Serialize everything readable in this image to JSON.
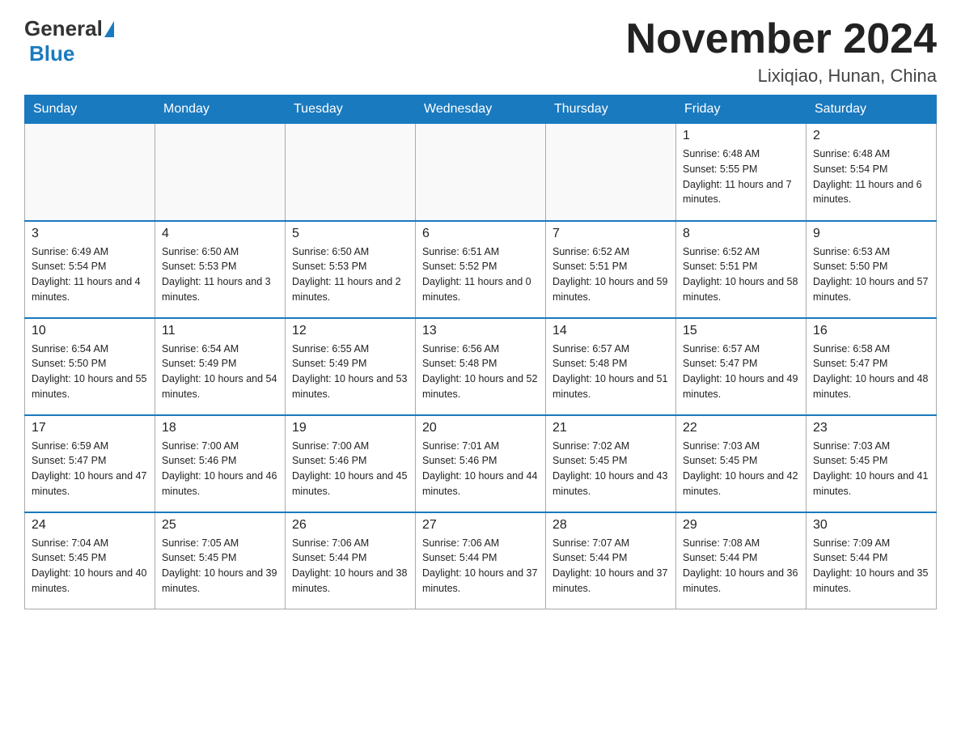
{
  "logo": {
    "general": "General",
    "blue": "Blue"
  },
  "title": "November 2024",
  "location": "Lixiqiao, Hunan, China",
  "days_of_week": [
    "Sunday",
    "Monday",
    "Tuesday",
    "Wednesday",
    "Thursday",
    "Friday",
    "Saturday"
  ],
  "weeks": [
    [
      {
        "day": "",
        "info": ""
      },
      {
        "day": "",
        "info": ""
      },
      {
        "day": "",
        "info": ""
      },
      {
        "day": "",
        "info": ""
      },
      {
        "day": "",
        "info": ""
      },
      {
        "day": "1",
        "info": "Sunrise: 6:48 AM\nSunset: 5:55 PM\nDaylight: 11 hours and 7 minutes."
      },
      {
        "day": "2",
        "info": "Sunrise: 6:48 AM\nSunset: 5:54 PM\nDaylight: 11 hours and 6 minutes."
      }
    ],
    [
      {
        "day": "3",
        "info": "Sunrise: 6:49 AM\nSunset: 5:54 PM\nDaylight: 11 hours and 4 minutes."
      },
      {
        "day": "4",
        "info": "Sunrise: 6:50 AM\nSunset: 5:53 PM\nDaylight: 11 hours and 3 minutes."
      },
      {
        "day": "5",
        "info": "Sunrise: 6:50 AM\nSunset: 5:53 PM\nDaylight: 11 hours and 2 minutes."
      },
      {
        "day": "6",
        "info": "Sunrise: 6:51 AM\nSunset: 5:52 PM\nDaylight: 11 hours and 0 minutes."
      },
      {
        "day": "7",
        "info": "Sunrise: 6:52 AM\nSunset: 5:51 PM\nDaylight: 10 hours and 59 minutes."
      },
      {
        "day": "8",
        "info": "Sunrise: 6:52 AM\nSunset: 5:51 PM\nDaylight: 10 hours and 58 minutes."
      },
      {
        "day": "9",
        "info": "Sunrise: 6:53 AM\nSunset: 5:50 PM\nDaylight: 10 hours and 57 minutes."
      }
    ],
    [
      {
        "day": "10",
        "info": "Sunrise: 6:54 AM\nSunset: 5:50 PM\nDaylight: 10 hours and 55 minutes."
      },
      {
        "day": "11",
        "info": "Sunrise: 6:54 AM\nSunset: 5:49 PM\nDaylight: 10 hours and 54 minutes."
      },
      {
        "day": "12",
        "info": "Sunrise: 6:55 AM\nSunset: 5:49 PM\nDaylight: 10 hours and 53 minutes."
      },
      {
        "day": "13",
        "info": "Sunrise: 6:56 AM\nSunset: 5:48 PM\nDaylight: 10 hours and 52 minutes."
      },
      {
        "day": "14",
        "info": "Sunrise: 6:57 AM\nSunset: 5:48 PM\nDaylight: 10 hours and 51 minutes."
      },
      {
        "day": "15",
        "info": "Sunrise: 6:57 AM\nSunset: 5:47 PM\nDaylight: 10 hours and 49 minutes."
      },
      {
        "day": "16",
        "info": "Sunrise: 6:58 AM\nSunset: 5:47 PM\nDaylight: 10 hours and 48 minutes."
      }
    ],
    [
      {
        "day": "17",
        "info": "Sunrise: 6:59 AM\nSunset: 5:47 PM\nDaylight: 10 hours and 47 minutes."
      },
      {
        "day": "18",
        "info": "Sunrise: 7:00 AM\nSunset: 5:46 PM\nDaylight: 10 hours and 46 minutes."
      },
      {
        "day": "19",
        "info": "Sunrise: 7:00 AM\nSunset: 5:46 PM\nDaylight: 10 hours and 45 minutes."
      },
      {
        "day": "20",
        "info": "Sunrise: 7:01 AM\nSunset: 5:46 PM\nDaylight: 10 hours and 44 minutes."
      },
      {
        "day": "21",
        "info": "Sunrise: 7:02 AM\nSunset: 5:45 PM\nDaylight: 10 hours and 43 minutes."
      },
      {
        "day": "22",
        "info": "Sunrise: 7:03 AM\nSunset: 5:45 PM\nDaylight: 10 hours and 42 minutes."
      },
      {
        "day": "23",
        "info": "Sunrise: 7:03 AM\nSunset: 5:45 PM\nDaylight: 10 hours and 41 minutes."
      }
    ],
    [
      {
        "day": "24",
        "info": "Sunrise: 7:04 AM\nSunset: 5:45 PM\nDaylight: 10 hours and 40 minutes."
      },
      {
        "day": "25",
        "info": "Sunrise: 7:05 AM\nSunset: 5:45 PM\nDaylight: 10 hours and 39 minutes."
      },
      {
        "day": "26",
        "info": "Sunrise: 7:06 AM\nSunset: 5:44 PM\nDaylight: 10 hours and 38 minutes."
      },
      {
        "day": "27",
        "info": "Sunrise: 7:06 AM\nSunset: 5:44 PM\nDaylight: 10 hours and 37 minutes."
      },
      {
        "day": "28",
        "info": "Sunrise: 7:07 AM\nSunset: 5:44 PM\nDaylight: 10 hours and 37 minutes."
      },
      {
        "day": "29",
        "info": "Sunrise: 7:08 AM\nSunset: 5:44 PM\nDaylight: 10 hours and 36 minutes."
      },
      {
        "day": "30",
        "info": "Sunrise: 7:09 AM\nSunset: 5:44 PM\nDaylight: 10 hours and 35 minutes."
      }
    ]
  ]
}
